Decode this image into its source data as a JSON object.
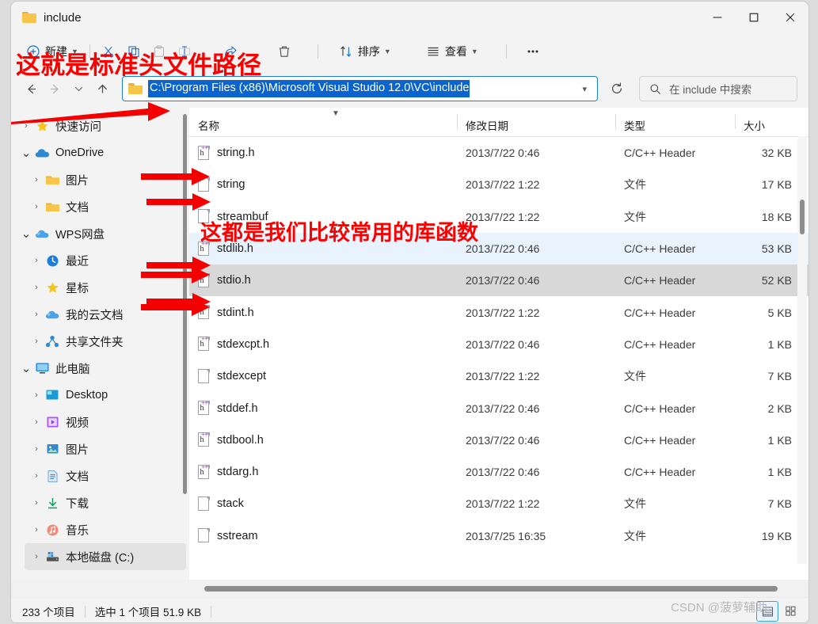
{
  "window": {
    "tab_title": "include",
    "minimize_label": "最小化",
    "maximize_label": "最大化",
    "close_label": "关闭"
  },
  "toolbar": {
    "new_label": "新建",
    "cut_label": "剪切",
    "copy_label": "复制",
    "paste_label": "粘贴",
    "rename_label": "重命名",
    "share_label": "共享",
    "delete_label": "删除",
    "sort_label": "排序",
    "view_label": "查看",
    "more_label": "查看更多"
  },
  "navigation": {
    "back_label": "后退",
    "forward_label": "前进",
    "recent_label": "最近的位置",
    "up_label": "向上",
    "refresh_label": "刷新",
    "address_value": "C:\\Program Files (x86)\\Microsoft Visual Studio 12.0\\VC\\include",
    "search_placeholder": "在 include 中搜索"
  },
  "sidebar": {
    "items": [
      {
        "label": "快速访问",
        "icon": "star-icon",
        "indent": 0,
        "expanded": false,
        "selected": false
      },
      {
        "label": "OneDrive",
        "icon": "cloud-icon",
        "indent": 0,
        "expanded": true,
        "selected": false
      },
      {
        "label": "图片",
        "icon": "folder-icon",
        "indent": 1,
        "expanded": false,
        "selected": false
      },
      {
        "label": "文档",
        "icon": "folder-icon",
        "indent": 1,
        "expanded": false,
        "selected": false
      },
      {
        "label": "WPS网盘",
        "icon": "wps-cloud-icon",
        "indent": 0,
        "expanded": true,
        "selected": false
      },
      {
        "label": "最近",
        "icon": "clock-icon",
        "indent": 1,
        "expanded": false,
        "selected": false
      },
      {
        "label": "星标",
        "icon": "star-icon",
        "indent": 1,
        "expanded": false,
        "selected": false
      },
      {
        "label": "我的云文档",
        "icon": "wps-cloud-icon",
        "indent": 1,
        "expanded": false,
        "selected": false
      },
      {
        "label": "共享文件夹",
        "icon": "share-nodes-icon",
        "indent": 1,
        "expanded": false,
        "selected": false
      },
      {
        "label": "此电脑",
        "icon": "monitor-icon",
        "indent": 0,
        "expanded": true,
        "selected": false
      },
      {
        "label": "Desktop",
        "icon": "desktop-icon",
        "indent": 1,
        "expanded": false,
        "selected": false
      },
      {
        "label": "视频",
        "icon": "video-icon",
        "indent": 1,
        "expanded": false,
        "selected": false
      },
      {
        "label": "图片",
        "icon": "pictures-icon",
        "indent": 1,
        "expanded": false,
        "selected": false
      },
      {
        "label": "文档",
        "icon": "documents-icon",
        "indent": 1,
        "expanded": false,
        "selected": false
      },
      {
        "label": "下载",
        "icon": "download-icon",
        "indent": 1,
        "expanded": false,
        "selected": false
      },
      {
        "label": "音乐",
        "icon": "music-icon",
        "indent": 1,
        "expanded": false,
        "selected": false
      },
      {
        "label": "本地磁盘 (C:)",
        "icon": "drive-icon",
        "indent": 1,
        "expanded": false,
        "selected": true
      }
    ]
  },
  "filelist": {
    "columns": [
      "名称",
      "修改日期",
      "类型",
      "大小"
    ],
    "sorted_column": "名称",
    "rows": [
      {
        "name": "string.h",
        "date": "2013/7/22 0:46",
        "type": "C/C++ Header",
        "size": "32 KB",
        "icon": "header-file-icon",
        "state": "normal"
      },
      {
        "name": "string",
        "date": "2013/7/22 1:22",
        "type": "文件",
        "size": "17 KB",
        "icon": "plain-file-icon",
        "state": "normal"
      },
      {
        "name": "streambuf",
        "date": "2013/7/22 1:22",
        "type": "文件",
        "size": "18 KB",
        "icon": "plain-file-icon",
        "state": "normal"
      },
      {
        "name": "stdlib.h",
        "date": "2013/7/22 0:46",
        "type": "C/C++ Header",
        "size": "53 KB",
        "icon": "header-file-icon",
        "state": "selected"
      },
      {
        "name": "stdio.h",
        "date": "2013/7/22 0:46",
        "type": "C/C++ Header",
        "size": "52 KB",
        "icon": "header-file-icon",
        "state": "hover"
      },
      {
        "name": "stdint.h",
        "date": "2013/7/22 1:22",
        "type": "C/C++ Header",
        "size": "5 KB",
        "icon": "header-file-icon",
        "state": "normal"
      },
      {
        "name": "stdexcpt.h",
        "date": "2013/7/22 0:46",
        "type": "C/C++ Header",
        "size": "1 KB",
        "icon": "header-file-icon",
        "state": "normal"
      },
      {
        "name": "stdexcept",
        "date": "2013/7/22 1:22",
        "type": "文件",
        "size": "7 KB",
        "icon": "plain-file-icon",
        "state": "normal"
      },
      {
        "name": "stddef.h",
        "date": "2013/7/22 0:46",
        "type": "C/C++ Header",
        "size": "2 KB",
        "icon": "header-file-icon",
        "state": "normal"
      },
      {
        "name": "stdbool.h",
        "date": "2013/7/22 0:46",
        "type": "C/C++ Header",
        "size": "1 KB",
        "icon": "header-file-icon",
        "state": "normal"
      },
      {
        "name": "stdarg.h",
        "date": "2013/7/22 0:46",
        "type": "C/C++ Header",
        "size": "1 KB",
        "icon": "header-file-icon",
        "state": "normal"
      },
      {
        "name": "stack",
        "date": "2013/7/22 1:22",
        "type": "文件",
        "size": "7 KB",
        "icon": "plain-file-icon",
        "state": "normal"
      },
      {
        "name": "sstream",
        "date": "2013/7/25 16:35",
        "type": "文件",
        "size": "19 KB",
        "icon": "plain-file-icon",
        "state": "normal"
      }
    ]
  },
  "statusbar": {
    "item_count": "233 个项目",
    "selection": "选中 1 个项目  51.9 KB",
    "view_details_label": "详细信息视图",
    "view_large_label": "大图标视图"
  },
  "annotations": [
    {
      "id": "anno1",
      "text": "这就是标准头文件路径",
      "color": "#fa0000"
    },
    {
      "id": "anno2",
      "text": "这都是我们比较常用的库函数",
      "color": "#fa0000"
    }
  ],
  "watermark": {
    "text": "CSDN @菠萝辅助"
  },
  "colors": {
    "accent": "#0b63ce",
    "selection_row": "#e8f3fd",
    "hover_row": "#d8d8d8",
    "annotation_red": "#fa0000"
  }
}
